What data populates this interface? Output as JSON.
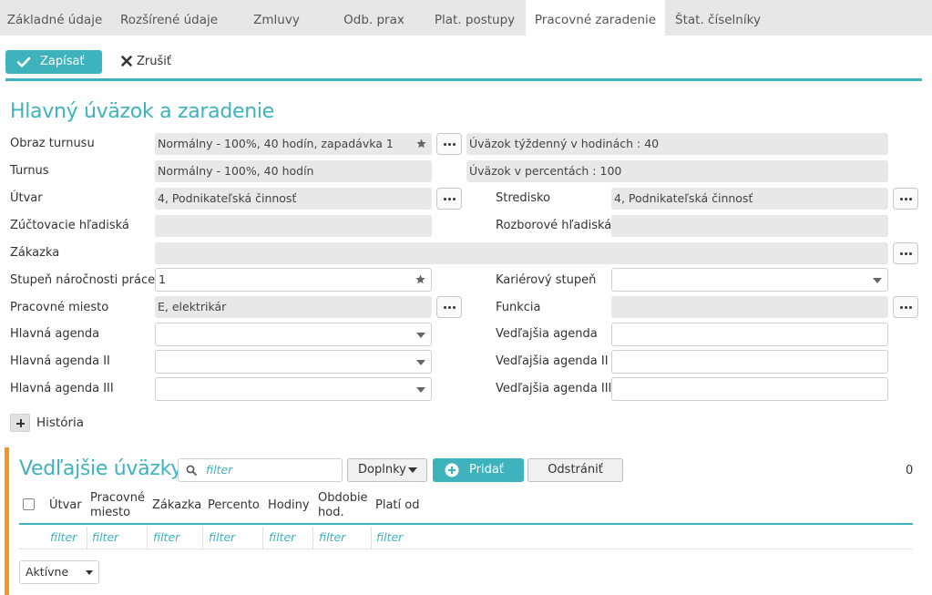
{
  "tabs": [
    {
      "label": "Základné údaje"
    },
    {
      "label": "Rozšírené údaje"
    },
    {
      "label": "Zmluvy"
    },
    {
      "label": "Odb. prax"
    },
    {
      "label": "Plat. postupy"
    },
    {
      "label": "Pracovné zaradenie",
      "active": true
    },
    {
      "label": "Štat. číselníky"
    }
  ],
  "toolbar": {
    "save_label": "Zapísať",
    "cancel_label": "Zrušiť"
  },
  "colors": {
    "accent": "#3fb3bd",
    "section_bar": "#f29a1e",
    "readonly_bg": "#e8e8e8"
  },
  "main": {
    "title": "Hlavný úväzok a zaradenie",
    "obraz_turnusu": {
      "label": "Obraz turnusu",
      "value": "Normálny - 100%, 40 hodín, zapadávka 1"
    },
    "uvazok_tyzdenny": {
      "value": "Úväzok týždenný v hodinách : 40"
    },
    "turnus": {
      "label": "Turnus",
      "value": "Normálny - 100%, 40 hodín"
    },
    "uvazok_percenta": {
      "value": "Úväzok v percentách : 100"
    },
    "utvar": {
      "label": "Útvar",
      "value": "4, Podnikateľská činnosť"
    },
    "stredisko": {
      "label": "Stredisko",
      "value": "4, Podnikateľská činnosť"
    },
    "zuctovacie": {
      "label": "Zúčtovacie hľadiská",
      "value": ""
    },
    "rozborove": {
      "label": "Rozborové hľadiská",
      "value": ""
    },
    "zakazka": {
      "label": "Zákazka",
      "value": ""
    },
    "stupen": {
      "label": "Stupeň náročnosti práce",
      "value": "1"
    },
    "karierovy": {
      "label": "Kariérový stupeň",
      "value": ""
    },
    "pracovne_miesto": {
      "label": "Pracovné miesto",
      "value": "E, elektrikár"
    },
    "funkcia": {
      "label": "Funkcia",
      "value": ""
    },
    "hlavna_agenda": {
      "label": "Hlavná agenda",
      "value": ""
    },
    "vedlajsia_agenda": {
      "label": "Vedľajšia agenda",
      "value": ""
    },
    "hlavna_agenda2": {
      "label": "Hlavná agenda II",
      "value": ""
    },
    "vedlajsia_agenda2": {
      "label": "Vedľajšia agenda II",
      "value": ""
    },
    "hlavna_agenda3": {
      "label": "Hlavná agenda III",
      "value": ""
    },
    "vedlajsia_agenda3": {
      "label": "Vedľajšia agenda III",
      "value": ""
    },
    "historia_label": "História"
  },
  "secondary": {
    "title": "Vedľajšie úväzky",
    "filter_placeholder": "filter",
    "doplnky_label": "Doplnky",
    "pridat_label": "Pridať",
    "odstranit_label": "Odstrániť",
    "count": "0",
    "columns": [
      {
        "line1": "Útvar",
        "line2": ""
      },
      {
        "line1": "Pracovné",
        "line2": "miesto"
      },
      {
        "line1": "Zákazka",
        "line2": ""
      },
      {
        "line1": "Percento",
        "line2": ""
      },
      {
        "line1": "Hodiny",
        "line2": ""
      },
      {
        "line1": "Obdobie",
        "line2": "hod."
      },
      {
        "line1": "Platí od",
        "line2": ""
      }
    ],
    "filter_cells": [
      "filter",
      "filter",
      "filter",
      "filter",
      "filter",
      "filter",
      "filter"
    ],
    "status_select": "Aktívne"
  }
}
